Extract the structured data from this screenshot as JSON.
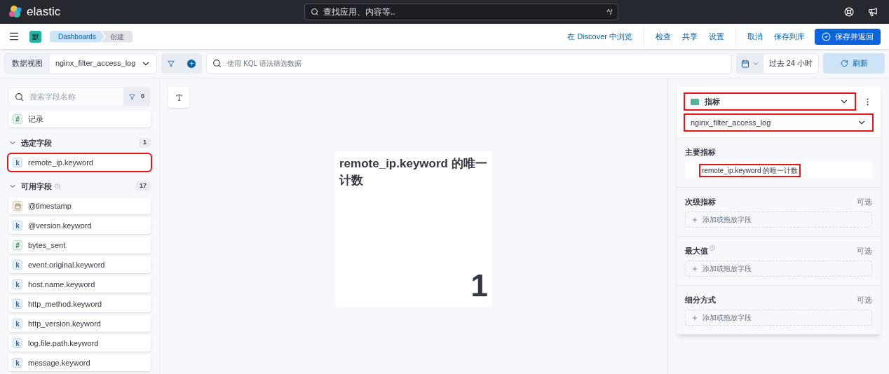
{
  "header": {
    "logo_text": "elastic",
    "search": {
      "placeholder": "查找应用、内容等..",
      "shortcut": "^/"
    }
  },
  "nav": {
    "app_badge": "默",
    "breadcrumbs": [
      {
        "label": "Dashboards",
        "selected": false
      },
      {
        "label": "创建",
        "selected": true
      }
    ],
    "links": [
      "在 Discover 中浏览",
      "检查",
      "共享",
      "设置",
      "取消",
      "保存到库"
    ],
    "primary_button": "保存并返回"
  },
  "query_bar": {
    "data_view_label": "数据视图",
    "data_view": "nginx_filter_access_log",
    "query": {
      "placeholder": "使用 KQL 语法筛选数据"
    },
    "time_range": "过去 24 小时",
    "refresh_button": "刷新"
  },
  "field_list": {
    "search": {
      "placeholder": "搜索字段名称"
    },
    "filter_count": "0",
    "records": {
      "kind": "number",
      "icon": "#",
      "name": "记录"
    },
    "sections": [
      {
        "title": "选定字段",
        "count": "1",
        "expanded": true,
        "help": false,
        "fields": [
          {
            "kind": "keyword",
            "icon": "k",
            "name": "remote_ip.keyword",
            "highlighted": true
          }
        ]
      },
      {
        "title": "可用字段",
        "count": "17",
        "expanded": true,
        "help": true,
        "fields": [
          {
            "kind": "date",
            "name": "@timestamp",
            "highlighted": false
          },
          {
            "kind": "keyword",
            "icon": "k",
            "name": "@version.keyword",
            "highlighted": false
          },
          {
            "kind": "number",
            "icon": "#",
            "name": "bytes_sent",
            "highlighted": false
          },
          {
            "kind": "keyword",
            "icon": "k",
            "name": "event.original.keyword",
            "highlighted": false
          },
          {
            "kind": "keyword",
            "icon": "k",
            "name": "host.name.keyword",
            "highlighted": false
          },
          {
            "kind": "keyword",
            "icon": "k",
            "name": "http_method.keyword",
            "highlighted": false
          },
          {
            "kind": "keyword",
            "icon": "k",
            "name": "http_version.keyword",
            "highlighted": false
          },
          {
            "kind": "keyword",
            "icon": "k",
            "name": "log.file.path.keyword",
            "highlighted": false
          },
          {
            "kind": "keyword",
            "icon": "k",
            "name": "message.keyword",
            "highlighted": false
          }
        ]
      }
    ]
  },
  "metric_panel": {
    "title": "remote_ip.keyword 的唯一计数",
    "value": "1"
  },
  "layer": {
    "vis_type": {
      "label": "指标",
      "highlighted": true
    },
    "data_view": {
      "label": "nginx_filter_access_log",
      "highlighted": true
    },
    "groups": [
      {
        "title": "主要指标",
        "help": false,
        "dimension": "remote_ip.keyword 的唯一计数",
        "dimension_highlighted": true
      },
      {
        "title": "次级指标",
        "help": false,
        "optional": "可选",
        "add": "添加或拖放字段"
      },
      {
        "title": "最大值",
        "help": true,
        "optional": "可选",
        "add": "添加或拖放字段"
      },
      {
        "title": "细分方式",
        "help": false,
        "optional": "可选",
        "add": "添加或拖放字段"
      }
    ]
  }
}
